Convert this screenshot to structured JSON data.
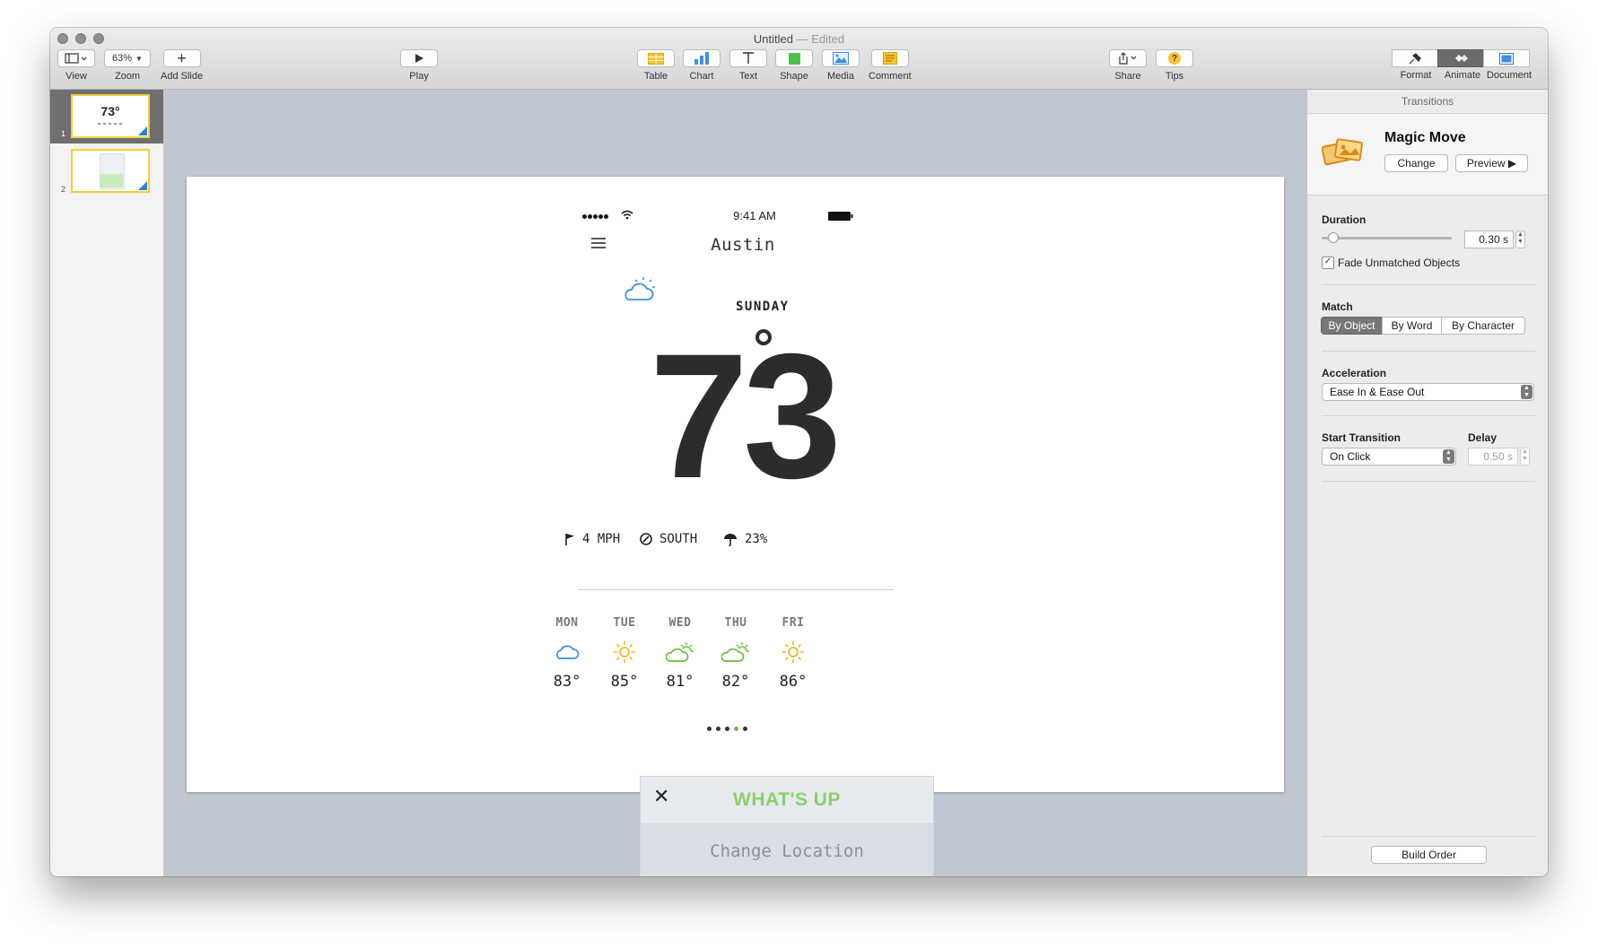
{
  "window": {
    "title": "Untitled",
    "title_separator": "—",
    "title_status": "Edited"
  },
  "toolbar": {
    "view_label": "View",
    "zoom_value": "63%",
    "zoom_label": "Zoom",
    "add_slide_label": "Add Slide",
    "play_label": "Play",
    "table_label": "Table",
    "chart_label": "Chart",
    "text_label": "Text",
    "shape_label": "Shape",
    "media_label": "Media",
    "comment_label": "Comment",
    "share_label": "Share",
    "tips_label": "Tips",
    "format_label": "Format",
    "animate_label": "Animate",
    "document_label": "Document",
    "active_inspector": "Animate"
  },
  "navigator": {
    "slides": [
      {
        "number": "1",
        "thumb_text": "73°",
        "selected": true
      },
      {
        "number": "2",
        "thumb_text": "",
        "selected": false
      }
    ]
  },
  "slide": {
    "status_time": "9:41 AM",
    "city": "Austin",
    "day": "SUNDAY",
    "day_icon": "partly-cloudy-icon",
    "temperature": "73",
    "degree_symbol": "°",
    "metrics": [
      {
        "icon": "flag-icon",
        "value": "4 MPH"
      },
      {
        "icon": "compass-icon",
        "value": "SOUTH"
      },
      {
        "icon": "umbrella-icon",
        "value": "23%"
      }
    ],
    "forecast": [
      {
        "day": "MON",
        "icon": "cloud-icon",
        "temp": "83°",
        "color": "#3d8fe0"
      },
      {
        "day": "TUE",
        "icon": "sun-icon",
        "temp": "85°",
        "color": "#f5b31f"
      },
      {
        "day": "WED",
        "icon": "partly-cloudy-icon",
        "temp": "81°",
        "color": "#6bbf3a"
      },
      {
        "day": "THU",
        "icon": "partly-cloudy-icon",
        "temp": "82°",
        "color": "#6bbf3a"
      },
      {
        "day": "FRI",
        "icon": "sun-icon",
        "temp": "86°",
        "color": "#f5b31f"
      }
    ],
    "page_dots": {
      "count": 5,
      "active_index": 3
    },
    "menu_title": "WHAT'S UP",
    "menu_item": "Change Location",
    "accent_color": "#6bbf3a"
  },
  "inspector": {
    "header": "Transitions",
    "effect_name": "Magic Move",
    "change_label": "Change",
    "preview_label": "Preview ▶",
    "duration_label": "Duration",
    "duration_value": "0.30 s",
    "duration_fraction": 0.05,
    "fade_label": "Fade Unmatched Objects",
    "fade_checked": true,
    "match_label": "Match",
    "match_options": [
      "By Object",
      "By Word",
      "By Character"
    ],
    "match_selected": "By Object",
    "acceleration_label": "Acceleration",
    "acceleration_value": "Ease In & Ease Out",
    "start_label": "Start Transition",
    "start_value": "On Click",
    "delay_label": "Delay",
    "delay_value": "0.50 s",
    "build_order_label": "Build Order"
  }
}
